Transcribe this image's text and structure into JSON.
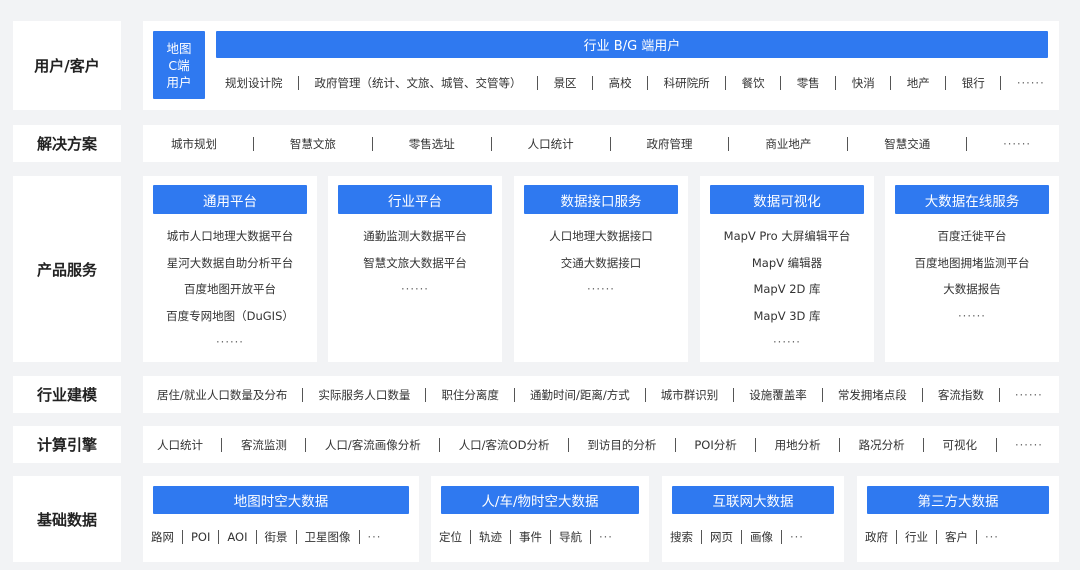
{
  "rows": {
    "users": {
      "label": "用户/客户",
      "c_end": [
        "地图",
        "C端",
        "用户"
      ],
      "bg_end": "行业 B/G 端用户",
      "items": [
        "规划设计院",
        "政府管理（统计、文旅、城管、交管等）",
        "景区",
        "高校",
        "科研院所",
        "餐饮",
        "零售",
        "快消",
        "地产",
        "银行",
        "······"
      ]
    },
    "solutions": {
      "label": "解决方案",
      "items": [
        "城市规划",
        "智慧文旅",
        "零售选址",
        "人口统计",
        "政府管理",
        "商业地产",
        "智慧交通",
        "······"
      ]
    },
    "products": {
      "label": "产品服务",
      "cards": [
        {
          "title": "通用平台",
          "items": [
            "城市人口地理大数据平台",
            "星河大数据自助分析平台",
            "百度地图开放平台",
            "百度专网地图（DuGIS）",
            "······"
          ]
        },
        {
          "title": "行业平台",
          "items": [
            "通勤监测大数据平台",
            "智慧文旅大数据平台",
            "······"
          ]
        },
        {
          "title": "数据接口服务",
          "items": [
            "人口地理大数据接口",
            "交通大数据接口",
            "······"
          ]
        },
        {
          "title": "数据可视化",
          "items": [
            "MapV Pro 大屏编辑平台",
            "MapV 编辑器",
            "MapV 2D 库",
            "MapV 3D 库",
            "······"
          ]
        },
        {
          "title": "大数据在线服务",
          "items": [
            "百度迁徙平台",
            "百度地图拥堵监测平台",
            "大数据报告",
            "······"
          ]
        }
      ]
    },
    "modeling": {
      "label": "行业建模",
      "items": [
        "居住/就业人口数量及分布",
        "实际服务人口数量",
        "职住分离度",
        "通勤时间/距离/方式",
        "城市群识别",
        "设施覆盖率",
        "常发拥堵点段",
        "客流指数",
        "······"
      ]
    },
    "engine": {
      "label": "计算引擎",
      "items": [
        "人口统计",
        "客流监测",
        "人口/客流画像分析",
        "人口/客流OD分析",
        "到访目的分析",
        "POI分析",
        "用地分析",
        "路况分析",
        "可视化",
        "······"
      ]
    },
    "base": {
      "label": "基础数据",
      "cards": [
        {
          "title": "地图时空大数据",
          "items": [
            "路网",
            "POI",
            "AOI",
            "街景",
            "卫星图像",
            "···"
          ]
        },
        {
          "title": "人/车/物时空大数据",
          "items": [
            "定位",
            "轨迹",
            "事件",
            "导航",
            "···"
          ]
        },
        {
          "title": "互联网大数据",
          "items": [
            "搜索",
            "网页",
            "画像",
            "···"
          ]
        },
        {
          "title": "第三方大数据",
          "items": [
            "政府",
            "行业",
            "客户",
            "···"
          ]
        }
      ]
    }
  },
  "colors": {
    "accent": "#2f79f0",
    "panel": "#ffffff",
    "background": "#f2f3f5"
  }
}
